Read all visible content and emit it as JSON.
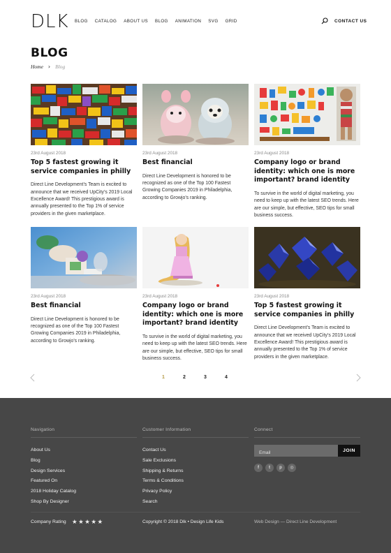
{
  "header": {
    "logo": "DLK",
    "nav": [
      "BLOG",
      "CATALOG",
      "ABOUT US",
      "BLOG",
      "ANIMATION",
      "SVG",
      "GRID"
    ],
    "contact": "CONTACT US"
  },
  "page": {
    "title": "BLOG",
    "breadcrumb": {
      "home": "Home",
      "current": "Blog"
    }
  },
  "posts": [
    {
      "date": "23rd August 2018",
      "title": "Top 5 fastest growing it service companies in philly",
      "excerpt": "Direct Line Development’s Team is excited to announce that we received UpCity’s 2019 Local Excellence Award! This prestigious award is annually presented to the Top 1% of service providers in the given marketplace.",
      "image": "lego-bricks"
    },
    {
      "date": "23rd August 2018",
      "title": "Best financial",
      "excerpt": "Direct Line Development is honored to be recognized as one of the Top 100 Fastest Growing Companies 2019 in Philadelphia, according to Growjo’s ranking.",
      "image": "toy-figurines"
    },
    {
      "date": "23rd August 2018",
      "title": "Company logo or brand identity: which one is more important? brand identity",
      "excerpt": "To survive in the world of digital marketing, you need to keep up with the latest SEO trends. Here are our simple, but effective, SEO tips for small business success.",
      "image": "colorful-toys"
    },
    {
      "date": "23rd August 2018",
      "title": "Best financial",
      "excerpt": "Direct Line Development is honored to be recognized as one of the Top 100 Fastest Growing Companies 2019 in Philadelphia, according to Growjo’s ranking.",
      "image": "toy-astronaut"
    },
    {
      "date": "23rd August 2018",
      "title": "Company logo or brand identity: which one is more important? brand identity",
      "excerpt": "To survive in the world of digital marketing, you need to keep up with the latest SEO trends. Here are our simple, but effective, SEO tips for small business success.",
      "image": "princess-figurine"
    },
    {
      "date": "23rd August 2018",
      "title": "Top 5 fastest growing it service companies in philly",
      "excerpt": "Direct Line Development’s Team is excited to announce that we received UpCity’s 2019 Local Excellence Award! This prestigious award is annually presented to the Top 1% of service providers in the given marketplace.",
      "image": "blue-crystals"
    }
  ],
  "pagination": {
    "pages": [
      "1",
      "2",
      "3",
      "4"
    ],
    "active": "1"
  },
  "footer": {
    "navigation": {
      "heading": "Navigation",
      "links": [
        "About Us",
        "Blog",
        "Design Services",
        "Featured On",
        "2018 Holiday Catalog",
        "Shop By Designer"
      ]
    },
    "customer": {
      "heading": "Customer Information",
      "links": [
        "Contact Us",
        "Sale Exclusions",
        "Shipping & Returns",
        "Terms & Conditions",
        "Privacy Policy",
        "Search"
      ]
    },
    "connect": {
      "heading": "Connect",
      "email_placeholder": "Email",
      "join_label": "JOIN",
      "socials": [
        "facebook-icon",
        "twitter-icon",
        "pinterest-icon",
        "instagram-icon"
      ]
    },
    "rating_label": "Company Rating",
    "stars": "★★★★★",
    "copyright": "Copyright © 2018 Dlk • Design Life Kids",
    "credit": "Web Design — Direct Line Development"
  },
  "colors": {
    "accent": "#b49a45",
    "footer_bg": "#474747"
  }
}
